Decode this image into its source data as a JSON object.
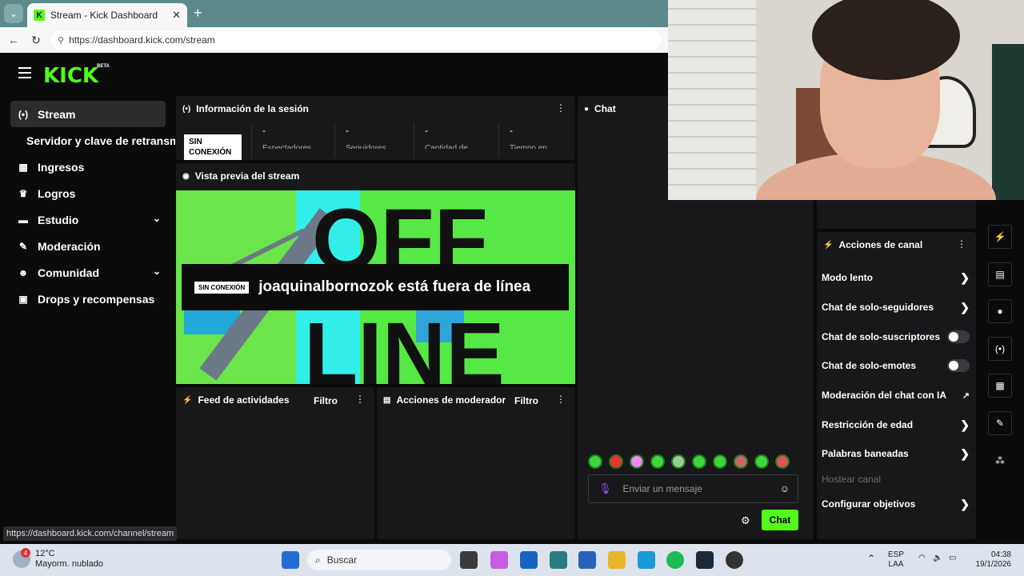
{
  "browser": {
    "tab_title": "Stream - Kick Dashboard",
    "url": "https://dashboard.kick.com/stream",
    "status_url": "https://dashboard.kick.com/channel/stream"
  },
  "logo": {
    "text": "KICK",
    "beta": "BETA"
  },
  "sidebar": {
    "items": [
      {
        "label": "Stream",
        "icon": "broadcast-icon"
      },
      {
        "label": "Servidor y clave de retransmisión",
        "icon": "server-icon"
      },
      {
        "label": "Ingresos",
        "icon": "chart-icon"
      },
      {
        "label": "Logros",
        "icon": "trophy-icon"
      },
      {
        "label": "Estudio",
        "icon": "studio-icon"
      },
      {
        "label": "Moderación",
        "icon": "wrench-icon"
      },
      {
        "label": "Comunidad",
        "icon": "people-icon"
      },
      {
        "label": "Drops y recompensas",
        "icon": "gift-icon"
      }
    ],
    "tooltip": "Servidor y clave de retransm"
  },
  "session": {
    "title": "Información de la sesión",
    "badge": "SIN CONEXIÓN",
    "stats": [
      {
        "value": "-",
        "label": "Espectadores"
      },
      {
        "value": "-",
        "label": "Seguidores"
      },
      {
        "value": "-",
        "label": "Cantidad de"
      },
      {
        "value": "-",
        "label": "Tiempo en"
      }
    ]
  },
  "preview": {
    "title": "Vista previa del stream",
    "badge": "SIN CONEXIÓN",
    "message": "joaquinalbornozok está fuera de línea"
  },
  "activity": {
    "title": "Feed de actividades",
    "filter": "Filtro"
  },
  "modactions": {
    "title": "Acciones de moderador",
    "filter": "Filtro"
  },
  "chat": {
    "title": "Chat",
    "placeholder": "Enviar un mensaje",
    "send": "Chat"
  },
  "channel_actions": {
    "title": "Acciones de canal",
    "items": [
      {
        "label": "Modo lento",
        "control": "arrow"
      },
      {
        "label": "Chat de solo-seguidores",
        "control": "arrow"
      },
      {
        "label": "Chat de solo-suscriptores",
        "control": "toggle"
      },
      {
        "label": "Chat de solo-emotes",
        "control": "toggle"
      },
      {
        "label": "Moderación del chat con IA",
        "control": "external"
      },
      {
        "label": "Restricción de edad",
        "control": "arrow"
      },
      {
        "label": "Palabras baneadas",
        "control": "arrow"
      },
      {
        "label": "Hostear canal",
        "control": "disabled"
      },
      {
        "label": "Configurar objetivos",
        "control": "arrow"
      }
    ]
  },
  "taskbar": {
    "temp": "12°C",
    "weather": "Mayorm. nublado",
    "weather_badge": "4",
    "search": "Buscar",
    "lang1": "ESP",
    "lang2": "LAA",
    "time": "04:38",
    "date": "19/1/2026"
  },
  "colors": {
    "accent": "#53fc18",
    "panel": "#18181a",
    "bg": "#0b0b0c"
  }
}
